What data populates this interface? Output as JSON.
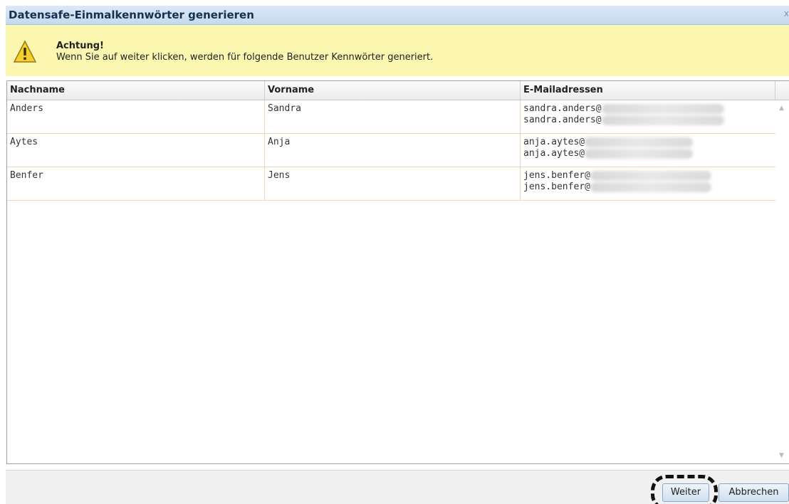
{
  "dialog": {
    "title": "Datensafe-Einmalkennwörter generieren",
    "close_glyph": "x"
  },
  "warning": {
    "icon": "warning-icon",
    "heading": "Achtung!",
    "message": "Wenn Sie auf weiter klicken, werden für folgende Benutzer Kennwörter generiert."
  },
  "table": {
    "columns": [
      "Nachname",
      "Vorname",
      "E-Mailadressen"
    ],
    "rows": [
      {
        "nachname": "Anders",
        "vorname": "Sandra",
        "emails": [
          "sandra.anders@",
          "sandra.anders@"
        ]
      },
      {
        "nachname": "Aytes",
        "vorname": "Anja",
        "emails": [
          "anja.aytes@",
          "anja.aytes@"
        ]
      },
      {
        "nachname": "Benfer",
        "vorname": "Jens",
        "emails": [
          "jens.benfer@",
          "jens.benfer@"
        ]
      }
    ]
  },
  "buttons": {
    "weiter": "Weiter",
    "abbrechen": "Abbrechen"
  },
  "colors": {
    "title_bar": "#c6d9ee",
    "warning_bg": "#fbf6b0",
    "row_border": "#f2d3b3"
  }
}
